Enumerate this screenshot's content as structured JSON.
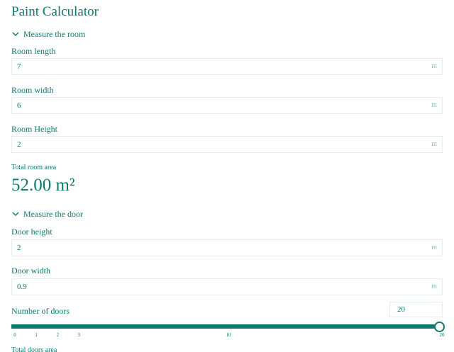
{
  "title": "Paint Calculator",
  "room_section": {
    "header": "Measure the room",
    "fields": [
      {
        "label": "Room length",
        "value": "7",
        "unit": "m"
      },
      {
        "label": "Room width",
        "value": "6",
        "unit": "m"
      },
      {
        "label": "Room Height",
        "value": "2",
        "unit": "m"
      }
    ],
    "total_label": "Total room area",
    "total_value": "52.00 m²"
  },
  "door_section": {
    "header": "Measure the door",
    "fields": [
      {
        "label": "Door height",
        "value": "2",
        "unit": "m"
      },
      {
        "label": "Door width",
        "value": "0.9",
        "unit": "m"
      }
    ],
    "count_label": "Number of doors",
    "count_value": "20",
    "slider": {
      "min": 0,
      "max": 20,
      "value": 20,
      "tick_labels": [
        "0",
        "1",
        "2",
        "3",
        "10",
        "20"
      ]
    },
    "total_label": "Total doors area"
  },
  "colors": {
    "accent": "#0b7a6c",
    "border": "#e3eeec",
    "unit_text": "#8fc7bd"
  },
  "icons": {
    "section_toggle": "chevron-down-icon"
  }
}
